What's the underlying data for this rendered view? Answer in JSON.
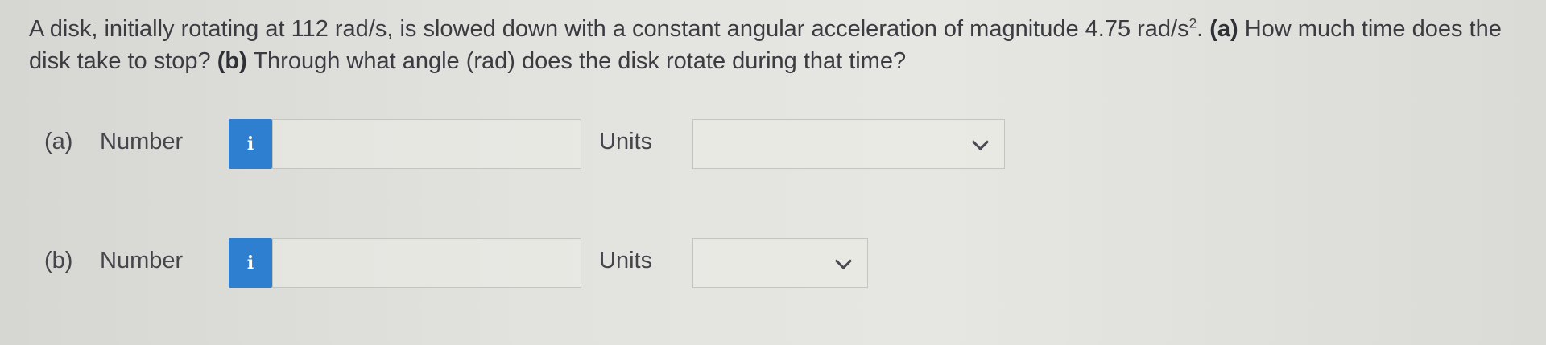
{
  "question": {
    "text_1": "A disk, initially rotating at 112 rad/s, is slowed down with a constant angular acceleration of magnitude 4.75 rad/s",
    "superscript": "2",
    "text_2": ". ",
    "part_a_marker": "(a)",
    "text_3": " How much time does the disk take to stop? ",
    "part_b_marker": "(b)",
    "text_4": " Through what angle (rad) does the disk rotate during that time?"
  },
  "part_a": {
    "label": "(a)",
    "number_label": "Number",
    "info_icon": "i",
    "number_value": "",
    "units_label": "Units",
    "units_value": ""
  },
  "part_b": {
    "label": "(b)",
    "number_label": "Number",
    "info_icon": "i",
    "number_value": "",
    "units_label": "Units",
    "units_value": ""
  },
  "colors": {
    "info_button": "#2f7fd0",
    "text": "#3b3b42",
    "background": "#e2e2de"
  }
}
